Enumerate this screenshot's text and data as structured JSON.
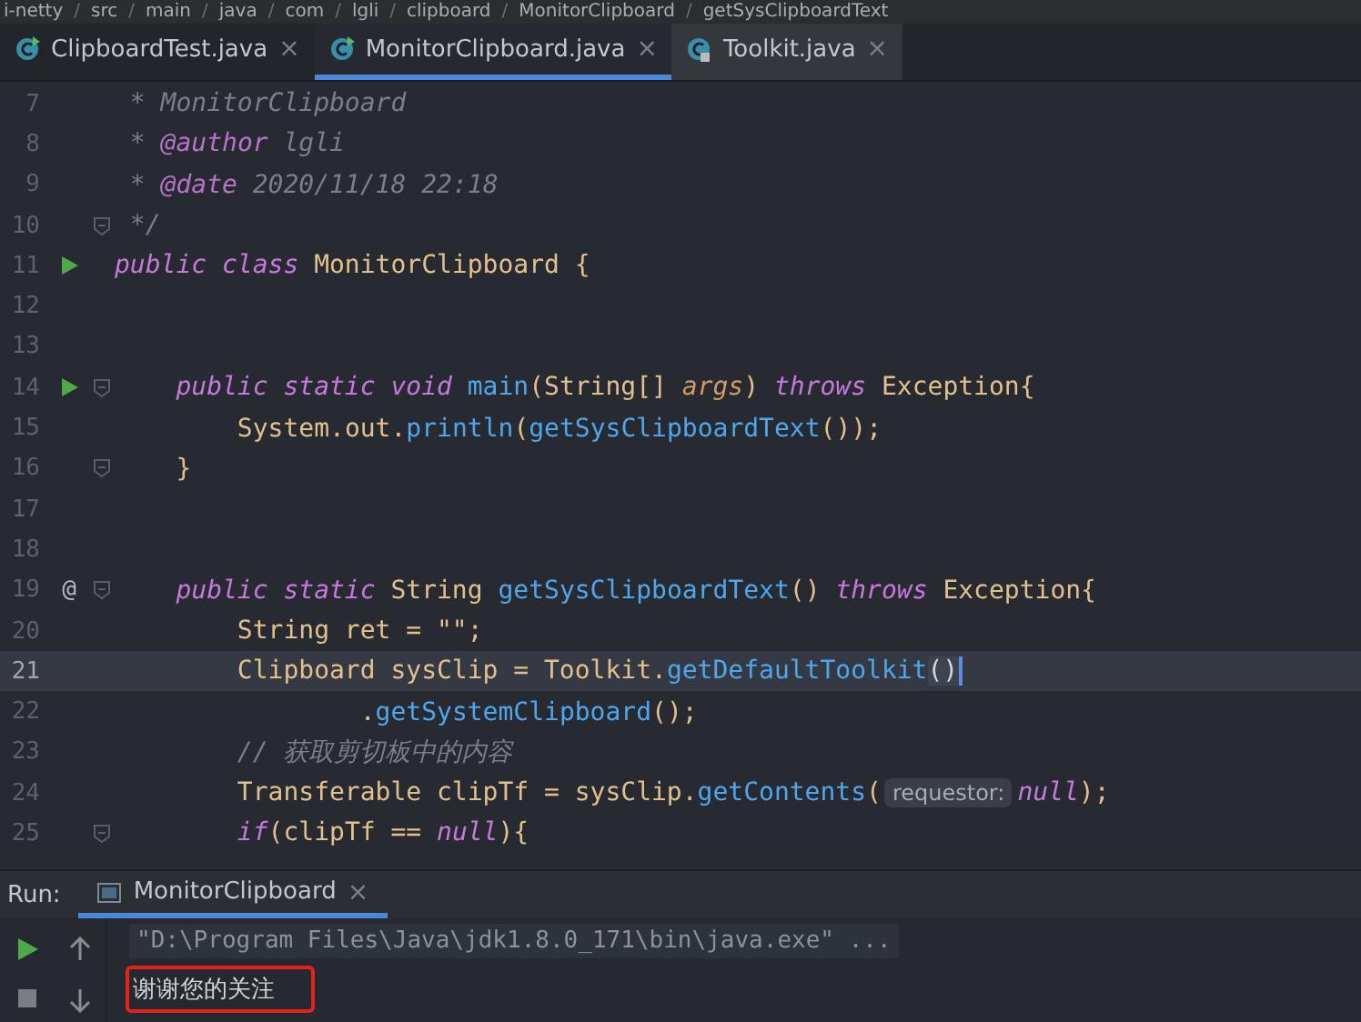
{
  "breadcrumb": [
    {
      "kind": "item",
      "text": "i-netty"
    },
    {
      "kind": "separator",
      "text": "/"
    },
    {
      "kind": "item",
      "text": "src"
    },
    {
      "kind": "separator",
      "text": "/"
    },
    {
      "kind": "item",
      "text": "main"
    },
    {
      "kind": "separator",
      "text": "/"
    },
    {
      "kind": "item",
      "text": "java"
    },
    {
      "kind": "separator",
      "text": "/"
    },
    {
      "kind": "item",
      "text": "com"
    },
    {
      "kind": "separator",
      "text": "/"
    },
    {
      "kind": "item",
      "text": "lgli"
    },
    {
      "kind": "separator",
      "text": "/"
    },
    {
      "kind": "item",
      "text": "clipboard"
    },
    {
      "kind": "separator",
      "text": "/"
    },
    {
      "kind": "item",
      "text": "MonitorClipboard"
    },
    {
      "kind": "separator",
      "text": "/"
    },
    {
      "kind": "item",
      "text": "getSysClipboardText"
    }
  ],
  "tabs": [
    {
      "label": "ClipboardTest.java",
      "kind": "class",
      "selected": false,
      "close": "×"
    },
    {
      "label": "MonitorClipboard.java",
      "kind": "class",
      "selected": true,
      "close": "×"
    },
    {
      "label": "Toolkit.java",
      "kind": "library",
      "selected": false,
      "close": "×"
    }
  ],
  "lines": [
    {
      "number": "7",
      "fold": false,
      "current": false,
      "tokens": [
        {
          "kind": "comment",
          "text": " * MonitorClipboard"
        }
      ]
    },
    {
      "number": "8",
      "fold": false,
      "current": false,
      "tokens": [
        {
          "kind": "comment",
          "text": " * "
        },
        {
          "kind": "doctag",
          "text": "@author"
        },
        {
          "kind": "comment",
          "text": " lgli"
        }
      ]
    },
    {
      "number": "9",
      "fold": false,
      "current": false,
      "tokens": [
        {
          "kind": "comment",
          "text": " * "
        },
        {
          "kind": "doctag",
          "text": "@date"
        },
        {
          "kind": "comment",
          "text": " 2020/11/18 22:18"
        }
      ]
    },
    {
      "number": "10",
      "fold": true,
      "current": false,
      "tokens": [
        {
          "kind": "comment",
          "text": " */"
        }
      ]
    },
    {
      "number": "11",
      "runnable": true,
      "fold": false,
      "current": false,
      "tokens": [
        {
          "kind": "kw",
          "text": "public class "
        },
        {
          "kind": "type",
          "text": "MonitorClipboard {"
        }
      ]
    },
    {
      "number": "12",
      "fold": false,
      "current": false
    },
    {
      "number": "13",
      "fold": false,
      "current": false
    },
    {
      "number": "14",
      "runnable": true,
      "fold": true,
      "current": false,
      "tokens": [
        {
          "kind": "kw",
          "text": "    public static void "
        },
        {
          "kind": "fn",
          "text": "main"
        },
        {
          "kind": "type",
          "text": "(String[] "
        },
        {
          "kind": "param",
          "text": "args"
        },
        {
          "kind": "type",
          "text": ") "
        },
        {
          "kind": "kw",
          "text": "throws "
        },
        {
          "kind": "type",
          "text": "Exception{"
        }
      ]
    },
    {
      "number": "15",
      "fold": false,
      "current": false,
      "tokens": [
        {
          "kind": "type",
          "text": "        System."
        },
        {
          "kind": "field",
          "text": "out"
        },
        {
          "kind": "type",
          "text": "."
        },
        {
          "kind": "fn",
          "text": "println"
        },
        {
          "kind": "type",
          "text": "("
        },
        {
          "kind": "fn",
          "text": "getSysClipboardText"
        },
        {
          "kind": "type",
          "text": "());"
        }
      ]
    },
    {
      "number": "16",
      "fold": true,
      "current": false,
      "tokens": [
        {
          "kind": "type",
          "text": "    }"
        }
      ]
    },
    {
      "number": "17",
      "fold": false,
      "current": false
    },
    {
      "number": "18",
      "fold": false,
      "current": false
    },
    {
      "number": "19",
      "marker": "@",
      "fold": true,
      "current": false,
      "tokens": [
        {
          "kind": "kw",
          "text": "    public static "
        },
        {
          "kind": "type",
          "text": "String "
        },
        {
          "kind": "fn",
          "text": "getSysClipboardText"
        },
        {
          "kind": "type",
          "text": "() "
        },
        {
          "kind": "kw",
          "text": "throws "
        },
        {
          "kind": "type",
          "text": "Exception{"
        }
      ]
    },
    {
      "number": "20",
      "fold": false,
      "current": false,
      "tokens": [
        {
          "kind": "type",
          "text": "        String ret = \"\";"
        }
      ]
    },
    {
      "number": "21",
      "fold": false,
      "current": true,
      "tokens": [
        {
          "kind": "type",
          "text": "        Clipboard sysClip = Toolkit."
        },
        {
          "kind": "fn",
          "text": "getDefaultToolkit"
        },
        {
          "kind": "match",
          "text": "()"
        }
      ]
    },
    {
      "number": "22",
      "fold": false,
      "current": false,
      "tokens": [
        {
          "kind": "type",
          "text": "                ."
        },
        {
          "kind": "fn",
          "text": "getSystemClipboard"
        },
        {
          "kind": "type",
          "text": "();"
        }
      ]
    },
    {
      "number": "23",
      "fold": false,
      "current": false,
      "tokens": [
        {
          "kind": "comment",
          "text": "        // 获取剪切板中的内容"
        }
      ]
    },
    {
      "number": "24",
      "fold": false,
      "current": false,
      "tokens": [
        {
          "kind": "type",
          "text": "        Transferable clipTf = sysClip."
        },
        {
          "kind": "fn",
          "text": "getContents"
        },
        {
          "kind": "type",
          "text": "("
        },
        {
          "kind": "hint",
          "text": "requestor:"
        },
        {
          "kind": "kw",
          "text": "null"
        },
        {
          "kind": "type",
          "text": ");"
        }
      ]
    },
    {
      "number": "25",
      "fold": true,
      "current": false,
      "tokens": [
        {
          "kind": "kw",
          "text": "        if"
        },
        {
          "kind": "type",
          "text": "(clipTf == "
        },
        {
          "kind": "kw",
          "text": "null"
        },
        {
          "kind": "type",
          "text": "){"
        }
      ]
    }
  ],
  "run_panel": {
    "label": "Run:",
    "tab": {
      "label": "MonitorClipboard",
      "selected": true,
      "close": "×"
    },
    "output": [
      {
        "kind": "command",
        "text": "\"D:\\Program Files\\Java\\jdk1.8.0_171\\bin\\java.exe\" ..."
      },
      {
        "kind": "highlighted",
        "text": "谢谢您的关注"
      }
    ]
  }
}
